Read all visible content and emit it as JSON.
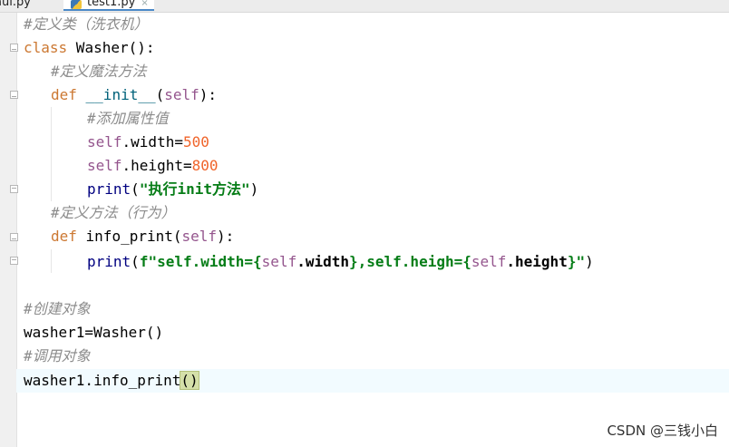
{
  "tabs": [
    {
      "label": "aui.py",
      "active": false
    },
    {
      "label": "test1.py",
      "active": true,
      "close": "×"
    }
  ],
  "code": {
    "l1": "#定义类（洗衣机）",
    "l2_kw": "class",
    "l2_rest": " Washer():",
    "l3": "#定义魔法方法",
    "l4_kw": "def",
    "l4_name": " __init__",
    "l4_open": "(",
    "l4_self": "self",
    "l4_close": "):",
    "l5": "#添加属性值",
    "l6_self": "self",
    "l6_mid": ".width=",
    "l6_num": "500",
    "l7_self": "self",
    "l7_mid": ".height=",
    "l7_num": "800",
    "l8_fn": "print",
    "l8_open": "(",
    "l8_str": "\"执行init方法\"",
    "l8_close": ")",
    "l9": "#定义方法（行为）",
    "l10_kw": "def",
    "l10_name": " info_print",
    "l10_open": "(",
    "l10_self": "self",
    "l10_close": "):",
    "l11_fn": "print",
    "l11_open": "(",
    "l11_s1": "f\"self.width={",
    "l11_self1": "self",
    "l11_m1": ".width",
    "l11_s2": "},self.heigh={",
    "l11_self2": "self",
    "l11_m2": ".height",
    "l11_s3": "}\"",
    "l11_close": ")",
    "l13": "#创建对象",
    "l14": "washer1=Washer()",
    "l15": "#调用对象",
    "l16_a": "washer1.info_print",
    "l16_b": "()"
  },
  "watermark": "CSDN @三钱小白"
}
